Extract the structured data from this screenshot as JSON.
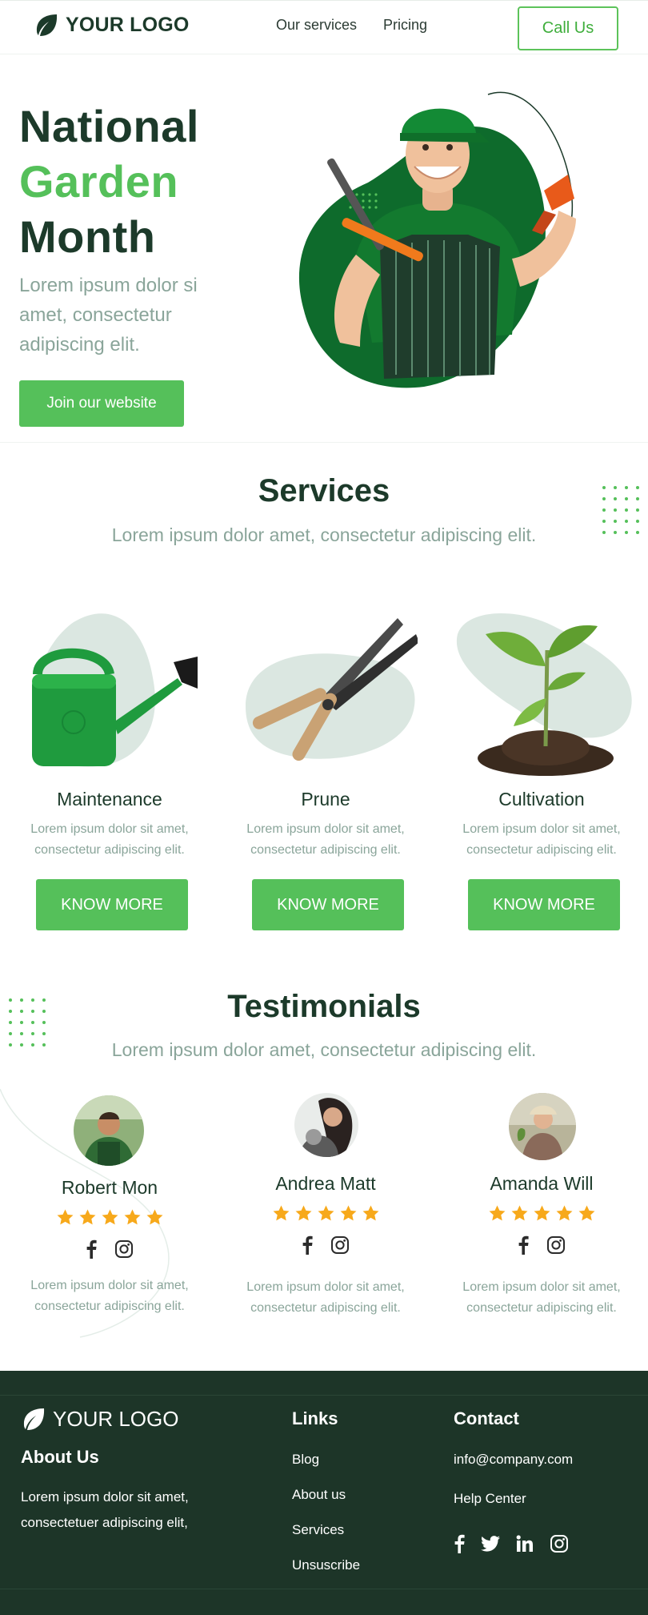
{
  "header": {
    "logo_text": "YOUR LOGO",
    "nav": [
      "Our services",
      "Pricing"
    ],
    "cta": "Call Us"
  },
  "hero": {
    "title_line1": "National",
    "title_line2": "Garden",
    "title_line3": "Month",
    "subtitle": "Lorem ipsum dolor si amet, consectetur adipiscing elit.",
    "button": "Join our website"
  },
  "services": {
    "title": "Services",
    "subtitle": "Lorem ipsum dolor amet, consectetur adipiscing elit.",
    "items": [
      {
        "name": "Maintenance",
        "desc": "Lorem ipsum dolor sit amet, consectetur adipiscing elit.",
        "button": "KNOW MORE",
        "icon": "watering-can-icon"
      },
      {
        "name": "Prune",
        "desc": "Lorem ipsum dolor sit amet, consectetur adipiscing elit.",
        "button": "KNOW MORE",
        "icon": "shears-icon"
      },
      {
        "name": "Cultivation",
        "desc": "Lorem ipsum dolor sit amet, consectetur adipiscing elit.",
        "button": "KNOW MORE",
        "icon": "seedling-icon"
      }
    ]
  },
  "testimonials": {
    "title": "Testimonials",
    "subtitle": "Lorem ipsum dolor amet, consectetur adipiscing elit.",
    "items": [
      {
        "name": "Robert Mon",
        "rating": 5,
        "desc": "Lorem ipsum dolor sit amet, consectetur adipiscing elit."
      },
      {
        "name": "Andrea Matt",
        "rating": 5,
        "desc": "Lorem ipsum dolor sit amet, consectetur adipiscing elit."
      },
      {
        "name": "Amanda Will",
        "rating": 5,
        "desc": "Lorem ipsum dolor sit amet, consectetur adipiscing elit."
      }
    ]
  },
  "footer": {
    "logo_text": "YOUR LOGO",
    "about_title": "About Us",
    "about_text": "Lorem ipsum dolor sit amet, consectetuer adipiscing elit,",
    "links_title": "Links",
    "links": [
      "Blog",
      "About us",
      "Services",
      "Unsuscribe"
    ],
    "contact_title": "Contact",
    "email": "info@company.com",
    "help": "Help Center",
    "social_icons": [
      "facebook-icon",
      "twitter-icon",
      "linkedin-icon",
      "instagram-icon"
    ]
  },
  "colors": {
    "brand_green": "#55c05a",
    "dark_green": "#1c3a2a",
    "footer_bg": "#1d3528",
    "muted_text": "#8aa59a",
    "star": "#f7a91b"
  }
}
